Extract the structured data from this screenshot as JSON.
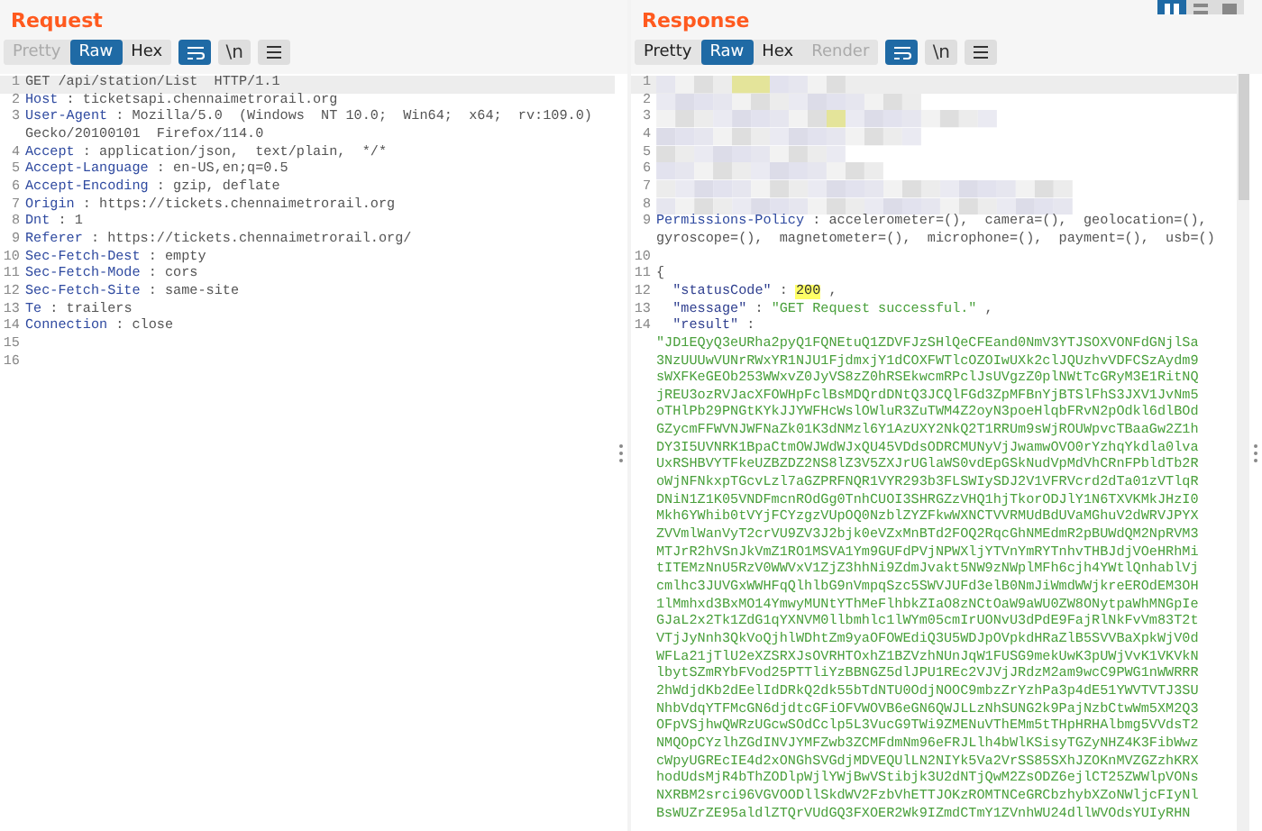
{
  "view_toggle": [
    {
      "selected": true
    },
    {
      "selected": false
    },
    {
      "selected": false
    }
  ],
  "request": {
    "title": "Request",
    "tabs": [
      {
        "label": "Pretty",
        "selected": false,
        "disabled": true
      },
      {
        "label": "Raw",
        "selected": true,
        "disabled": false
      },
      {
        "label": "Hex",
        "selected": false,
        "disabled": false
      }
    ],
    "tools": [
      {
        "kind": "wrap",
        "selected": true
      },
      {
        "kind": "text",
        "label": "\\n",
        "selected": false
      },
      {
        "kind": "menu",
        "selected": false
      }
    ],
    "lines": [
      {
        "number": "1",
        "kind": "plain",
        "text": "GET /api/station/List  HTTP/1.1",
        "highlighted": true
      },
      {
        "number": "2",
        "kind": "header",
        "name": "Host",
        "rest": ": ticketsapi.chennaimetrorail.org",
        "highlighted": false
      },
      {
        "number": "3",
        "kind": "header",
        "name": "User-Agent",
        "rest": ": Mozilla/5.0  (Windows  NT 10.0;  Win64;  x64;  rv:109.0) Gecko/20100101  Firefox/114.0",
        "highlighted": false
      },
      {
        "number": "4",
        "kind": "header",
        "name": "Accept",
        "rest": ": application/json,  text/plain,  */*",
        "highlighted": false
      },
      {
        "number": "5",
        "kind": "header",
        "name": "Accept-Language",
        "rest": ": en-US,en;q=0.5",
        "highlighted": false
      },
      {
        "number": "6",
        "kind": "header",
        "name": "Accept-Encoding",
        "rest": ": gzip, deflate",
        "highlighted": false
      },
      {
        "number": "7",
        "kind": "header",
        "name": "Origin",
        "rest": ": https://tickets.chennaimetrorail.org",
        "highlighted": false
      },
      {
        "number": "8",
        "kind": "header",
        "name": "Dnt",
        "rest": ": 1",
        "highlighted": false
      },
      {
        "number": "9",
        "kind": "header",
        "name": "Referer",
        "rest": ": https://tickets.chennaimetrorail.org/",
        "highlighted": false
      },
      {
        "number": "10",
        "kind": "header",
        "name": "Sec-Fetch-Dest",
        "rest": ": empty",
        "highlighted": false
      },
      {
        "number": "11",
        "kind": "header",
        "name": "Sec-Fetch-Mode",
        "rest": ": cors",
        "highlighted": false
      },
      {
        "number": "12",
        "kind": "header",
        "name": "Sec-Fetch-Site",
        "rest": ": same-site",
        "highlighted": false
      },
      {
        "number": "13",
        "kind": "header",
        "name": "Te",
        "rest": ": trailers",
        "highlighted": false
      },
      {
        "number": "14",
        "kind": "header",
        "name": "Connection",
        "rest": ": close",
        "highlighted": false
      },
      {
        "number": "15",
        "kind": "empty",
        "highlighted": false
      },
      {
        "number": "16",
        "kind": "empty",
        "highlighted": false
      }
    ]
  },
  "response": {
    "title": "Response",
    "tabs": [
      {
        "label": "Pretty",
        "selected": false,
        "disabled": false
      },
      {
        "label": "Raw",
        "selected": true,
        "disabled": false
      },
      {
        "label": "Hex",
        "selected": false,
        "disabled": false
      },
      {
        "label": "Render",
        "selected": false,
        "disabled": true
      }
    ],
    "tools": [
      {
        "kind": "wrap",
        "selected": true
      },
      {
        "kind": "text",
        "label": "\\n",
        "selected": false
      },
      {
        "kind": "menu",
        "selected": false
      }
    ],
    "lines": [
      {
        "number": "1",
        "kind": "redacted",
        "highlighted": true
      },
      {
        "number": "2",
        "kind": "redacted",
        "highlighted": false
      },
      {
        "number": "3",
        "kind": "redacted",
        "highlighted": false
      },
      {
        "number": "4",
        "kind": "redacted",
        "highlighted": false
      },
      {
        "number": "5",
        "kind": "redacted",
        "highlighted": false
      },
      {
        "number": "6",
        "kind": "redacted",
        "highlighted": false
      },
      {
        "number": "7",
        "kind": "redacted",
        "highlighted": false
      },
      {
        "number": "8",
        "kind": "redacted",
        "highlighted": false
      },
      {
        "number": "9",
        "kind": "header",
        "name": "Permissions-Policy",
        "rest": ": accelerometer=(),  camera=(),  geolocation=(), gyroscope=(),  magnetometer=(),  microphone=(),  payment=(),  usb=()",
        "highlighted": false
      },
      {
        "number": "10",
        "kind": "empty",
        "highlighted": false
      },
      {
        "number": "11",
        "kind": "plain",
        "text": "{",
        "highlighted": false
      },
      {
        "number": "12",
        "kind": "json-number",
        "key": "\"statusCode\"",
        "colon": ":",
        "value": "200",
        "comma": ",",
        "highlighted": false
      },
      {
        "number": "13",
        "kind": "json-string",
        "key": "\"message\"",
        "colon": ":",
        "value": "\"GET Request successful.\"",
        "comma": ",",
        "highlighted": false
      },
      {
        "number": "14",
        "kind": "json-long",
        "key": "\"result\"",
        "colon": ":",
        "value": "\"JD1EQyQ3eURha2pyQ1FQNEtuQ1ZDVFJzSHlQeCFEand0NmV3YTJSOXVONFdGNjlSa3NzUUUwVUNrRWxYR1NJU1FjdmxjY1dCOXFWTlcOZOIwUXk2clJQUzhvVDFCSzAydm9sWXFKeGEOb253WWxvZ0JyVS8zZ0hRSEkwcmRPclJsUVgzZ0plNWtTcGRyM3E1RitNQjREU3ozRVJacXFOWHpFclBsMDQrdDNtQ3JCQlFGd3ZpMFBnYjBTSlFhS3JXV1JvNm5oTHlPb29PNGtKYkJJYWFHcWslOWluR3ZuTWM4Z2oyN3poeHlqbFRvN2pOdkl6dlBOdGZycmFFWVNJWFNaZk01K3dNMzl6Y1AzUXY2NkQ2T1RRUm9sWjROUWpvcTBaaGw2Z1hDY3I5UVNRK1BpaCtmOWJWdWJxQU45VDdsODRCMUNyVjJwamwOVO0rYzhqYkdla0lvaUxRSHBVYTFkeUZBZDZ2NS8lZ3V5ZXJrUGlaWS0vdEpGSkNudVpMdVhCRnFPbldTb2RoWjNFNkxpTGcvLzl7aGZPRFNQR1VYR293b3FLSWIySDJ2V1VFRVcrd2dTa01zVTlqRDNiN1Z1K05VNDFmcnROdGg0TnhCUOI3SHRGZzVHQ1hjTkorODJlY1N6TXVKMkJHzI0Mkh6YWhib0tVYjFCYzgzVUpOQ0NzblZYZFkwWXNCTVVRMUdBdUVaMGhuV2dWRVJPYXZVVmlWanVyT2crVU9ZV3J2bjk0eVZxMnBTd2FOQ2RqcGhNMEdmR2pBUWdQM2NpRVM3MTJrR2hVSnJkVmZ1RO1MSVA1Ym9GUFdPVjNPWXljYTVnYmRYTnhvTHBJdjVOeHRhMitITEMzNnU5RzV0WWVxV1ZjZ3hhNi9ZdmJvakt5NW9zNWplMFh6cjh4YWtlQnhablVjcmlhc3JUVGxWWHFqQlhlbG9nVmpqSzc5SWVJUFd3elB0NmJiWmdWWjkreEROdEM3OH1lMmhxd3BxMO14YmwyMUNtYThMeFlhbkZIaO8zNCtOaW9aWU0ZW8ONytpaWhMNGpIeGJaL2x2Tk1ZdG1qYXNVM0llbmhlc1lWYm05cmIrUONvU3dPdE9FajRlNkFvVm83T2tVTjJyNnh3QkVoQjhlWDhtZm9yaOFOWEdiQ3U5WDJpOVpkdHRaZlB5SVVBaXpkWjV0dWFLa21jTlU2eXZSRXJsOVRHTOxhZ1BZVzhNUnJqW1FUSG9mekUwK3pUWjVvK1VKVkNlbytSZmRYbFVod25PTTliYzBBNGZ5dlJPU1REc2VJVjJRdzM2am9wcC9PWG1nWWRRR2hWdjdKb2dEelIdDRkQ2dk55bTdNTU0OdjNOOC9mbzZrYzhPa3p4dE51YWVTVTJ3SUNhbVdqYTFMcGN6djdtcGFiOFVWOVB6eGN6QWJLLzNhSUNG2k9PajNzbCtwWm5XM2Q3OFpVSjhwQWRzUGcwSOdCclp5L3VucG9TWi9ZMENuVThEMm5tTHpHRHAlbmg5VVdsT2NMQOpCYzlhZGdINVJYMFZwb3ZCMFdmNm96eFRJLlh4bWlKSisyTGZyNHZ4K3FibWwzcWpyUGREcIE4d2xONGhSVGdjMDVEQUlLN2NIYk5Va2VrSS85SXhJZOKnMVZGZzhKRXhodUdsMjR4bThZODlpWjlYWjBwVStibjk3U2dNTjQwM2ZsODZ6ejlCT25ZWWlpVONsNXRBM2srci96VGVOODllSkdWV2FzbVhETTJOKzROMTNCeGRCbzhybXZoNWljcFIyNlBsWUZrZE95aldlZTQrVUdGQ3FXOER2Wk9IZmdCTmY1ZVnhWU24dllWVOdsYUIyRHN",
        "highlighted": false
      }
    ]
  }
}
